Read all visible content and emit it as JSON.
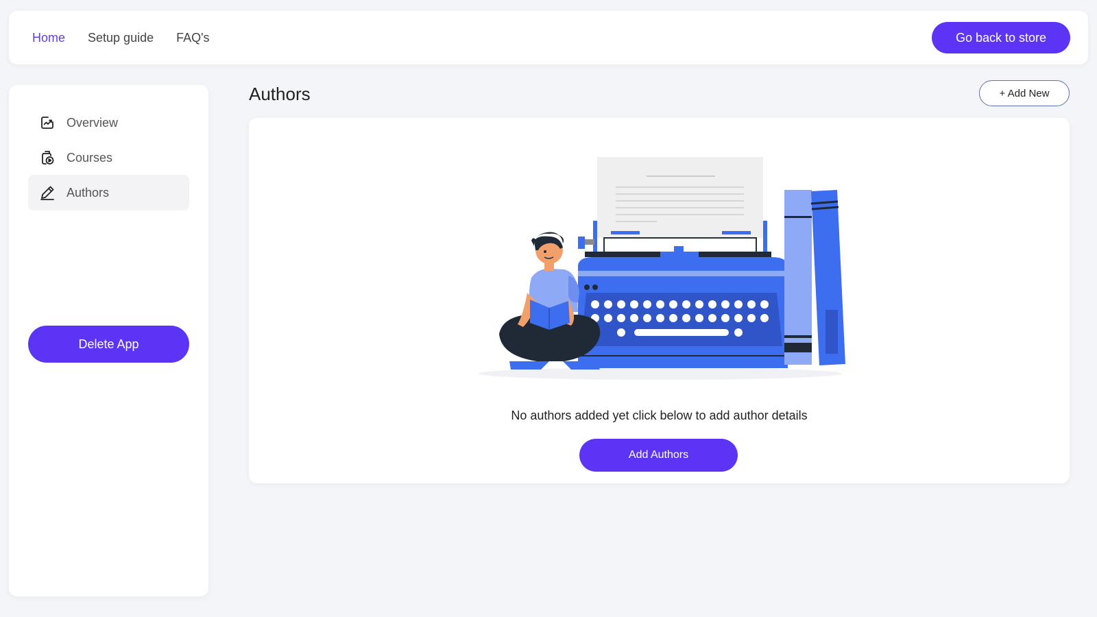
{
  "nav": {
    "links": [
      {
        "label": "Home",
        "active": true
      },
      {
        "label": "Setup guide",
        "active": false
      },
      {
        "label": "FAQ's",
        "active": false
      }
    ],
    "store_button": "Go back to store"
  },
  "sidebar": {
    "items": [
      {
        "label": "Overview",
        "icon": "overview-chart-icon",
        "active": false
      },
      {
        "label": "Courses",
        "icon": "courses-icon",
        "active": false
      },
      {
        "label": "Authors",
        "icon": "pen-icon",
        "active": true
      }
    ],
    "delete_button": "Delete App"
  },
  "main": {
    "title": "Authors",
    "add_new_button": "+ Add New",
    "empty_message": "No authors added yet click below to add author details",
    "add_authors_button": "Add Authors",
    "illustration": "person-reading-with-typewriter-illustration"
  },
  "colors": {
    "accent": "#5b34f5",
    "nav_active": "#5a3ff0",
    "background": "#f4f5f9",
    "illustration_blue": "#3d6ef0",
    "illustration_light_blue": "#8eaaf7"
  }
}
